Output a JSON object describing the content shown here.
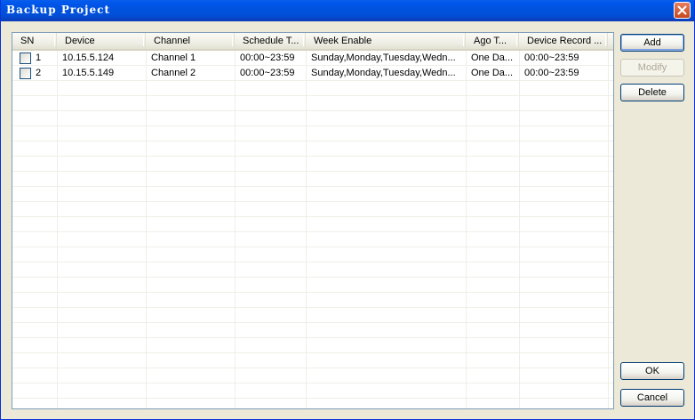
{
  "window": {
    "title": "Backup Project"
  },
  "table": {
    "columns": [
      "SN",
      "Device",
      "Channel",
      "Schedule T...",
      "Week Enable",
      "Ago T...",
      "Device Record ..."
    ],
    "rows": [
      {
        "sn": "1",
        "device": "10.15.5.124",
        "channel": "Channel 1",
        "schedule": "00:00~23:59",
        "week": "Sunday,Monday,Tuesday,Wedn...",
        "ago": "One Da...",
        "record": "00:00~23:59",
        "checked": false
      },
      {
        "sn": "2",
        "device": "10.15.5.149",
        "channel": "Channel 2",
        "schedule": "00:00~23:59",
        "week": "Sunday,Monday,Tuesday,Wedn...",
        "ago": "One Da...",
        "record": "00:00~23:59",
        "checked": false
      }
    ]
  },
  "buttons": {
    "add": "Add",
    "modify": "Modify",
    "delete": "Delete",
    "ok": "OK",
    "cancel": "Cancel"
  },
  "icons": {
    "close": "close-icon"
  },
  "colors": {
    "titlebar": "#0054e3",
    "dialog_bg": "#ece9d8",
    "button_border": "#003c74"
  }
}
